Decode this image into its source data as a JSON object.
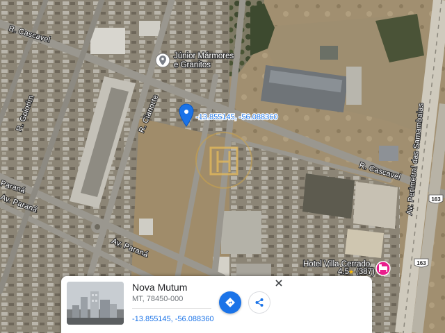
{
  "map": {
    "streets": {
      "cascavel_top": "R. Cascavel",
      "cascavel_right": "R. Cascavel",
      "goiorim": "R. Goiorim",
      "cianorte": "R. Cianorte",
      "parana_left": "Paraná",
      "parana_left2": "Av. Paraná",
      "parana_bottom": "Av. Paraná",
      "perimetral": "Av. Perimetral das Samambaias"
    },
    "shields": {
      "shield_a": "163",
      "shield_b": "163"
    },
    "pois": {
      "marmores_line1": "Júnior Mármores",
      "marmores_line2": "e Granitos",
      "hotel_name": "Hotel Villa Cerrado",
      "hotel_rating": "4.5",
      "hotel_stars": "★",
      "hotel_reviews": "(387)"
    },
    "pin_coordinates": "-13.855145, -56.088360",
    "colors": {
      "pin": "#1a73e8",
      "hotel_marker": "#e91e8c",
      "road": "#9a978f"
    }
  },
  "card": {
    "title": "Nova Mutum",
    "address": "MT, 78450-000",
    "coordinates": "-13.855145, -56.088360",
    "icons": {
      "directions": "directions-icon",
      "share": "share-icon",
      "close": "close-icon"
    }
  }
}
